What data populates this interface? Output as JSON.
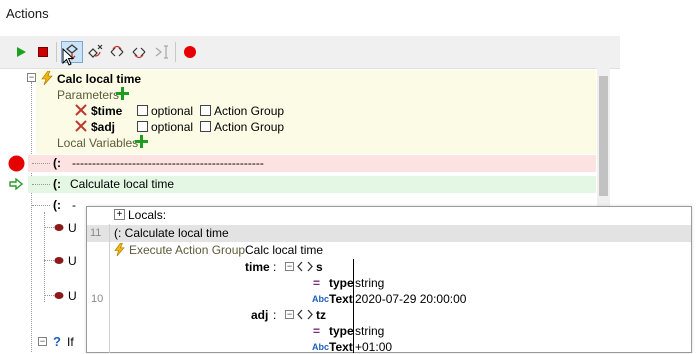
{
  "panel": {
    "title": "Actions"
  },
  "toolbar": {
    "buttons": [
      {
        "name": "run",
        "icon": "play-icon"
      },
      {
        "name": "stop",
        "icon": "stop-icon"
      },
      {
        "name": "step-into",
        "icon": "step-into-icon"
      },
      {
        "name": "step-out",
        "icon": "step-out-icon"
      },
      {
        "name": "step-over",
        "icon": "step-over-icon"
      },
      {
        "name": "step-back",
        "icon": "step-back-icon"
      },
      {
        "name": "run-to-cursor",
        "icon": "cursor-step-icon"
      },
      {
        "name": "breakpoint",
        "icon": "breakpoint-icon"
      }
    ]
  },
  "tree": {
    "action_group": "Calc local time",
    "parameters_label": "Parameters",
    "params": [
      {
        "name": "$time",
        "optional_label": "optional",
        "action_group_label": "Action Group"
      },
      {
        "name": "$adj",
        "optional_label": "optional",
        "action_group_label": "Action Group"
      }
    ],
    "local_variables_label": "Local Variables",
    "comment_prefix": "(:",
    "comment_dashes": "------------------------------------------------",
    "current_comment": "Calculate local time",
    "comment_partial": "-",
    "partial_if": "If",
    "partial_u": "U",
    "question_mark": "?"
  },
  "overlay": {
    "locals_label": "Locals:",
    "rows": [
      {
        "line": "11",
        "text": "(:  Calculate local time"
      },
      {
        "line": "10"
      }
    ],
    "execute_label": "Execute Action Group",
    "execute_value": "Calc local time",
    "vars": [
      {
        "name": "time",
        "sep": ":",
        "elem": "s",
        "type_label": "type",
        "type_value": "string",
        "text_label": "Text",
        "text_value": "2020-07-29 20:00:00"
      },
      {
        "name": "adj",
        "sep": ":",
        "elem": "tz",
        "type_label": "type",
        "type_value": "string",
        "text_label": "Text",
        "text_value": "+01:00"
      }
    ],
    "abc_mark": "Abc",
    "eq_mark": "="
  },
  "colors": {
    "breakpoint": "#e60000",
    "play": "#1aa31a",
    "stop": "#cc0000",
    "add": "#1e9e1e",
    "param_x": "#c0392b",
    "current_arrow": "#2c9b2c"
  }
}
